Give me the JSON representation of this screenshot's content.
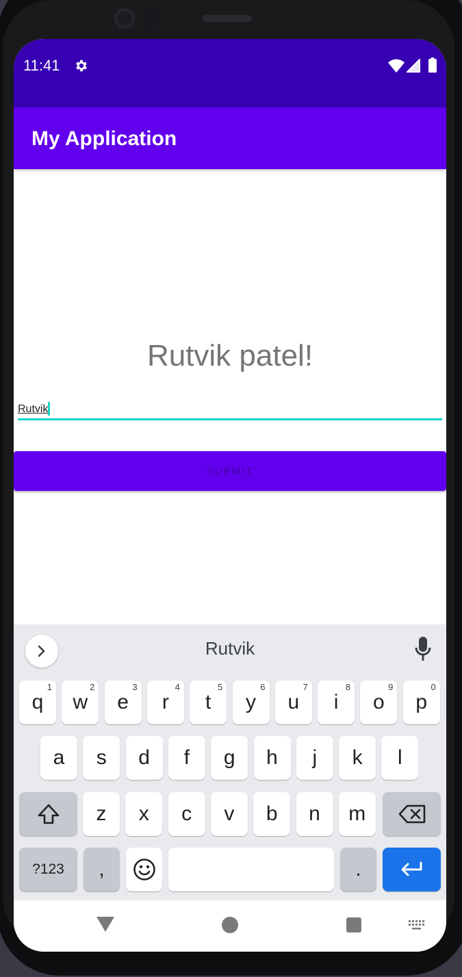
{
  "status_bar": {
    "time": "11:41",
    "icons": [
      "gear-icon",
      "wifi-icon",
      "signal-icon",
      "battery-icon"
    ],
    "color": "#3700b3"
  },
  "app_bar": {
    "title": "My Application",
    "color": "#6200ee"
  },
  "main": {
    "greeting": "Rutvik patel!",
    "name_field": {
      "value": "Rutvik",
      "accent_color": "#19d3c5"
    },
    "submit_label": "SUBMIT"
  },
  "keyboard": {
    "suggestion": "Rutvik",
    "row1": [
      {
        "k": "q",
        "h": "1"
      },
      {
        "k": "w",
        "h": "2"
      },
      {
        "k": "e",
        "h": "3"
      },
      {
        "k": "r",
        "h": "4"
      },
      {
        "k": "t",
        "h": "5"
      },
      {
        "k": "y",
        "h": "6"
      },
      {
        "k": "u",
        "h": "7"
      },
      {
        "k": "i",
        "h": "8"
      },
      {
        "k": "o",
        "h": "9"
      },
      {
        "k": "p",
        "h": "0"
      }
    ],
    "row2": [
      "a",
      "s",
      "d",
      "f",
      "g",
      "h",
      "j",
      "k",
      "l"
    ],
    "row3": [
      "z",
      "x",
      "c",
      "v",
      "b",
      "n",
      "m"
    ],
    "symbols_label": "?123",
    "comma_label": ",",
    "period_label": ".",
    "enter_color": "#1a73e8"
  },
  "nav_bar": {
    "icons": [
      "back-triangle-icon",
      "home-circle-icon",
      "recents-square-icon",
      "keyboard-switch-icon"
    ]
  }
}
